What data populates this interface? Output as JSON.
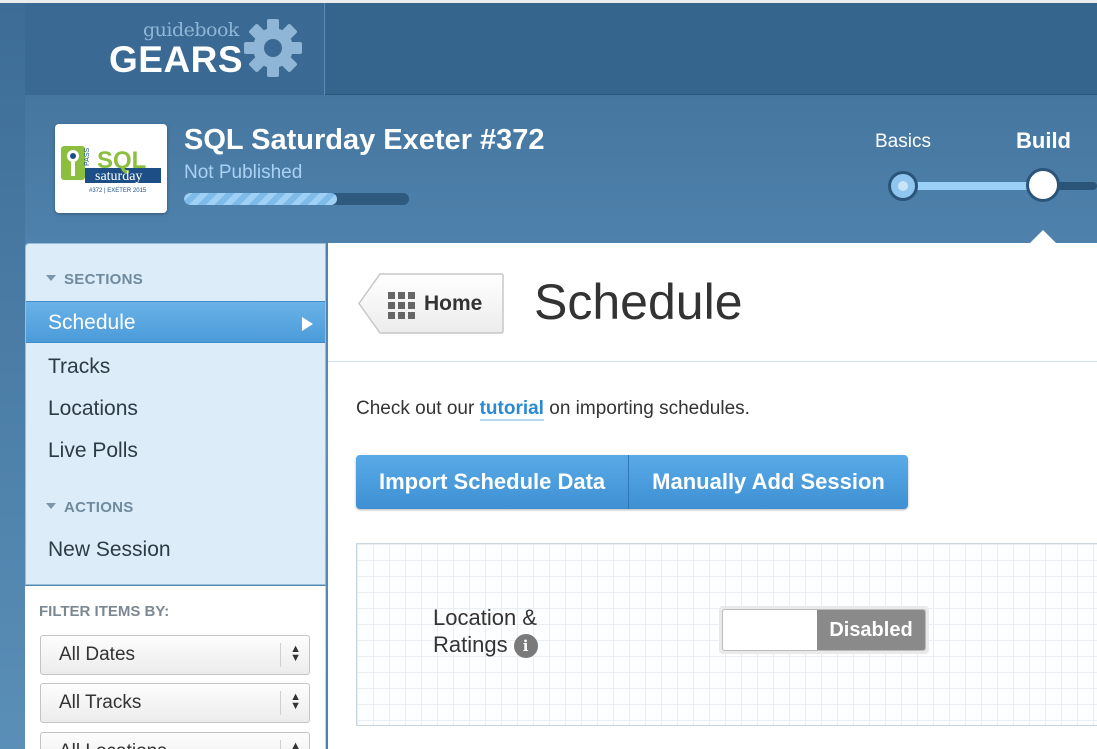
{
  "app": {
    "logo_sub": "guidebook",
    "logo_main": "GEARS"
  },
  "event": {
    "title": "SQL Saturday Exeter #372",
    "status": "Not Published",
    "thumb": {
      "pass": "PASS",
      "sql": "SQL",
      "saturday": "saturday",
      "tag": "#372 | EXETER 2015"
    },
    "progress": 0.68
  },
  "steps": {
    "basics": "Basics",
    "build": "Build"
  },
  "sidebar": {
    "sections_heading": "SECTIONS",
    "sections": [
      {
        "label": "Schedule",
        "active": true
      },
      {
        "label": "Tracks"
      },
      {
        "label": "Locations"
      },
      {
        "label": "Live Polls"
      }
    ],
    "actions_heading": "ACTIONS",
    "actions": [
      {
        "label": "New Session"
      }
    ]
  },
  "filter": {
    "title": "FILTER ITEMS BY:",
    "selects": [
      {
        "value": "All Dates"
      },
      {
        "value": "All Tracks"
      },
      {
        "value": "All Locations"
      }
    ]
  },
  "main": {
    "home_label": "Home",
    "page_title": "Schedule",
    "intro_before": "Check out our ",
    "intro_link": "tutorial",
    "intro_after": " on importing schedules.",
    "import_button": "Import Schedule Data",
    "add_button": "Manually Add Session",
    "location_label_1": "Location &",
    "location_label_2": "Ratings",
    "info_glyph": "i",
    "toggle_state": "Disabled"
  },
  "colors": {
    "accent": "#4b9bd9",
    "header_bg": "#35658d",
    "sidebar_bg": "#dcecf8",
    "toggle_disabled": "#8a8a8a"
  },
  "icons": {
    "logo": "gear-icon",
    "home": "grid-icon",
    "info": "info-icon"
  }
}
